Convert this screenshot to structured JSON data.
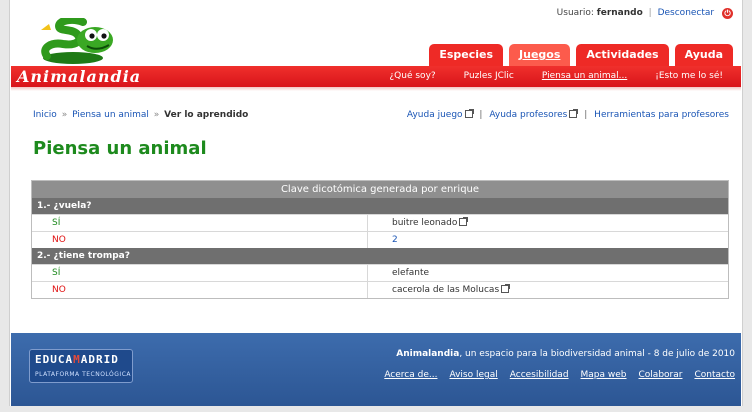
{
  "header": {
    "user_label": "Usuario:",
    "username": "fernando",
    "logout": "Desconectar",
    "brand": "Animalandia",
    "tabs": [
      {
        "label": "Especies"
      },
      {
        "label": "Juegos"
      },
      {
        "label": "Actividades"
      },
      {
        "label": "Ayuda"
      }
    ],
    "subnav": [
      {
        "label": "¿Qué soy?"
      },
      {
        "label": "Puzles JClic"
      },
      {
        "label": "Piensa un animal..."
      },
      {
        "label": "¡Esto me lo sé!"
      }
    ]
  },
  "breadcrumb": {
    "home": "Inicio",
    "section": "Piensa un animal",
    "current": "Ver lo aprendido",
    "arrow": "»"
  },
  "help_links": [
    {
      "label": "Ayuda juego"
    },
    {
      "label": "Ayuda profesores"
    },
    {
      "label": "Herramientas para profesores"
    }
  ],
  "page_title": "Piensa un animal",
  "key_table": {
    "caption": "Clave dicotómica generada por enrique",
    "questions": [
      {
        "question": "1.- ¿vuela?",
        "answers": [
          {
            "answer": "SÍ",
            "result": "buitre leonado"
          },
          {
            "answer": "NO",
            "result": "2"
          }
        ]
      },
      {
        "question": "2.- ¿tiene trompa?",
        "answers": [
          {
            "answer": "SÍ",
            "result": "elefante"
          },
          {
            "answer": "NO",
            "result": "cacerola de las Molucas"
          }
        ]
      }
    ]
  },
  "footer": {
    "logo_text_1": "EDUCA",
    "logo_text_accent": "M",
    "logo_text_2": "ADRID",
    "logo_sub": "PLATAFORMA TECNOLÓGICA",
    "tagline_bold": "Animalandia",
    "tagline_rest": ", un espacio para la biodiversidad animal - 8 de julio de 2010",
    "links": [
      {
        "label": "Acerca de..."
      },
      {
        "label": "Aviso legal"
      },
      {
        "label": "Accesibilidad"
      },
      {
        "label": "Mapa web"
      },
      {
        "label": "Colaborar"
      },
      {
        "label": "Contacto"
      }
    ]
  },
  "colors": {
    "brand_red": "#e8201e",
    "title_green": "#1d8a1d",
    "link_blue": "#1a55b5",
    "footer_blue": "#34609f"
  }
}
